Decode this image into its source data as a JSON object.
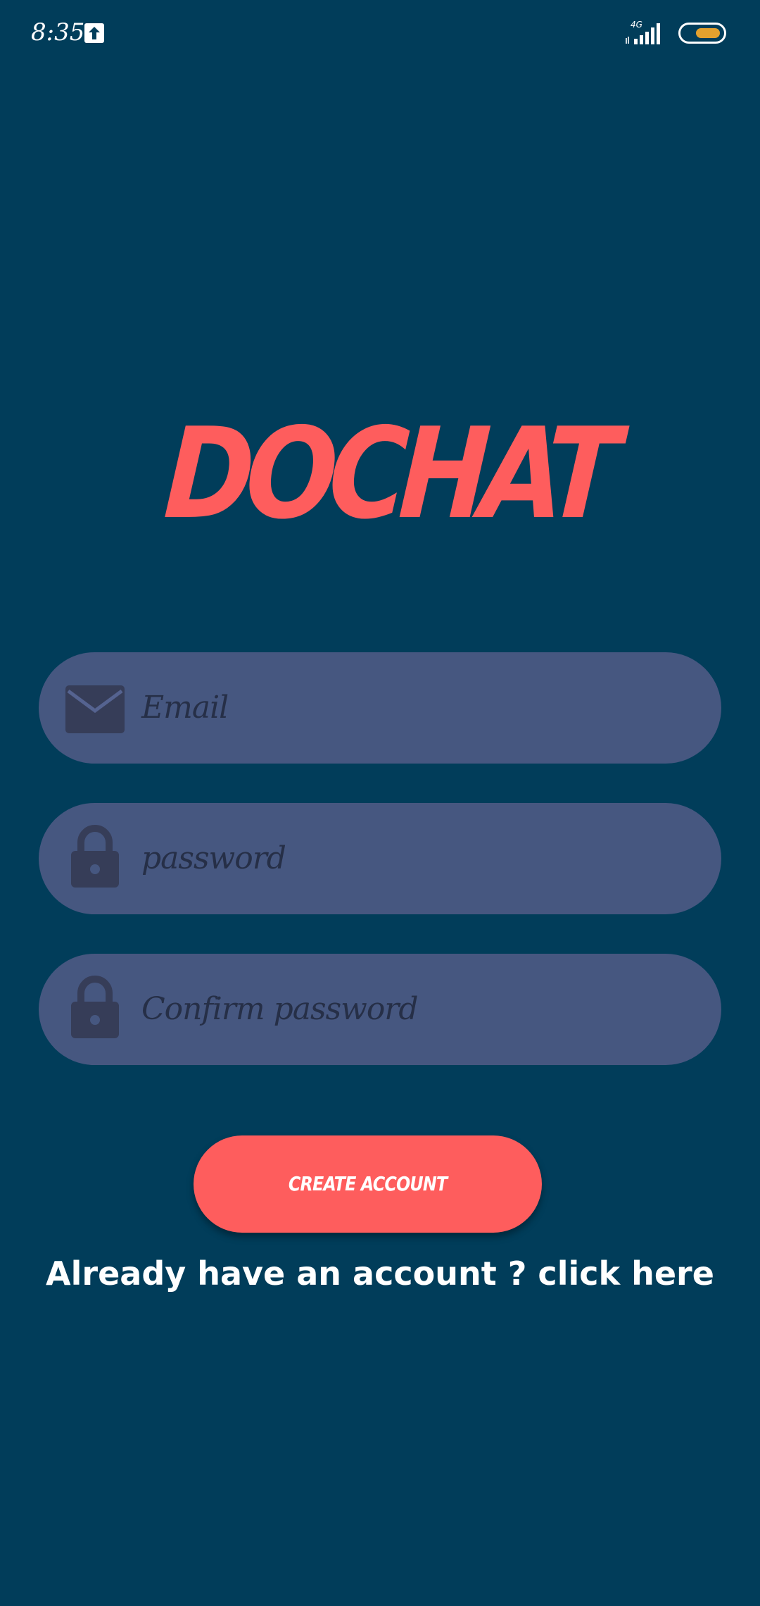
{
  "status_bar": {
    "time": "8:35",
    "network": "4G",
    "icons": [
      "upload-icon",
      "signal-icon",
      "battery-icon"
    ],
    "battery_color": "#e3a12e"
  },
  "logo": {
    "text": "DOCHAT",
    "color": "#fe5d5d"
  },
  "form": {
    "email": {
      "placeholder": "Email",
      "icon": "mail-icon"
    },
    "password": {
      "placeholder": "password",
      "icon": "lock-icon"
    },
    "confirm_password": {
      "placeholder": "Confirm password",
      "icon": "lock-icon"
    },
    "field_color": "#465780"
  },
  "create_button": {
    "label": "CREATE ACCOUNT",
    "color": "#fe5d5d"
  },
  "signin_link": {
    "text": "Already have an account ? click here"
  },
  "theme": {
    "background": "#013d5a"
  }
}
